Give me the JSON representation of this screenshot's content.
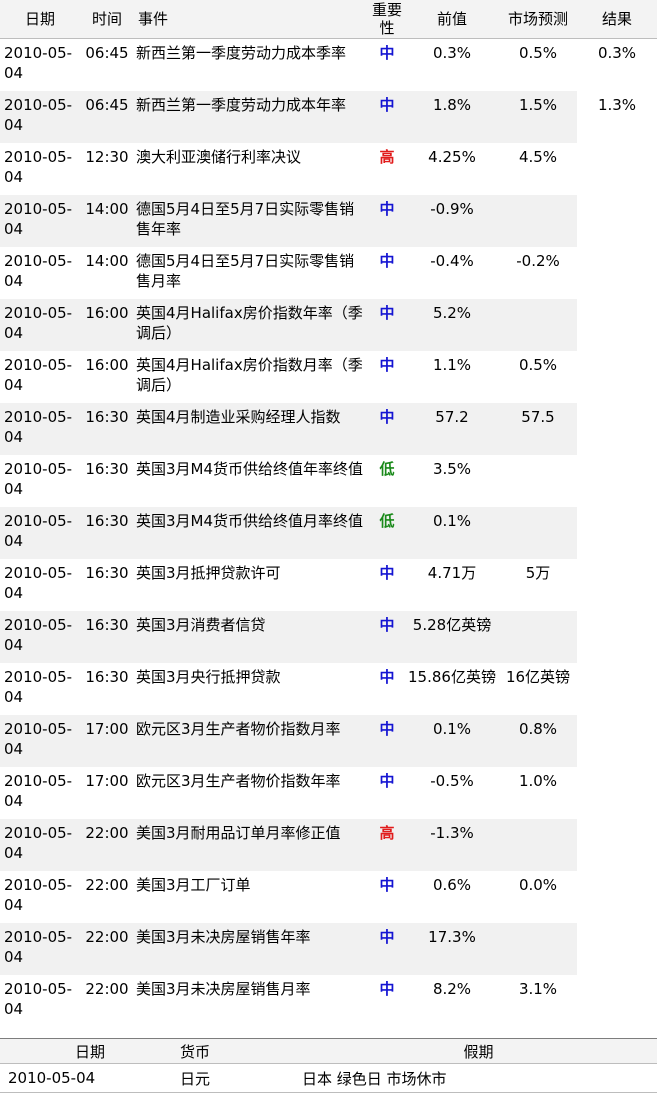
{
  "calendar": {
    "headers": {
      "date": "日期",
      "time": "时间",
      "event": "事件",
      "importance": "重要性",
      "previous": "前值",
      "forecast": "市场预测",
      "actual": "结果"
    },
    "rows": [
      {
        "date": "2010-05-04",
        "time": "06:45",
        "event": "新西兰第一季度劳动力成本季率",
        "importance": "中",
        "level": "mid",
        "previous": "0.3%",
        "forecast": "0.5%",
        "actual": "0.3%"
      },
      {
        "date": "2010-05-04",
        "time": "06:45",
        "event": "新西兰第一季度劳动力成本年率",
        "importance": "中",
        "level": "mid",
        "previous": "1.8%",
        "forecast": "1.5%",
        "actual": "1.3%"
      },
      {
        "date": "2010-05-04",
        "time": "12:30",
        "event": "澳大利亚澳储行利率决议",
        "importance": "高",
        "level": "high",
        "previous": "4.25%",
        "forecast": "4.5%",
        "actual": ""
      },
      {
        "date": "2010-05-04",
        "time": "14:00",
        "event": "德国5月4日至5月7日实际零售销售年率",
        "importance": "中",
        "level": "mid",
        "previous": "-0.9%",
        "forecast": "",
        "actual": ""
      },
      {
        "date": "2010-05-04",
        "time": "14:00",
        "event": "德国5月4日至5月7日实际零售销售月率",
        "importance": "中",
        "level": "mid",
        "previous": "-0.4%",
        "forecast": "-0.2%",
        "actual": ""
      },
      {
        "date": "2010-05-04",
        "time": "16:00",
        "event": "英国4月Halifax房价指数年率（季调后）",
        "importance": "中",
        "level": "mid",
        "previous": "5.2%",
        "forecast": "",
        "actual": ""
      },
      {
        "date": "2010-05-04",
        "time": "16:00",
        "event": "英国4月Halifax房价指数月率（季调后）",
        "importance": "中",
        "level": "mid",
        "previous": "1.1%",
        "forecast": "0.5%",
        "actual": ""
      },
      {
        "date": "2010-05-04",
        "time": "16:30",
        "event": "英国4月制造业采购经理人指数",
        "importance": "中",
        "level": "mid",
        "previous": "57.2",
        "forecast": "57.5",
        "actual": ""
      },
      {
        "date": "2010-05-04",
        "time": "16:30",
        "event": "英国3月M4货币供给终值年率终值",
        "importance": "低",
        "level": "low",
        "previous": "3.5%",
        "forecast": "",
        "actual": ""
      },
      {
        "date": "2010-05-04",
        "time": "16:30",
        "event": "英国3月M4货币供给终值月率终值",
        "importance": "低",
        "level": "low",
        "previous": "0.1%",
        "forecast": "",
        "actual": ""
      },
      {
        "date": "2010-05-04",
        "time": "16:30",
        "event": "英国3月抵押贷款许可",
        "importance": "中",
        "level": "mid",
        "previous": "4.71万",
        "forecast": "5万",
        "actual": ""
      },
      {
        "date": "2010-05-04",
        "time": "16:30",
        "event": "英国3月消费者信贷",
        "importance": "中",
        "level": "mid",
        "previous": "5.28亿英镑",
        "forecast": "",
        "actual": ""
      },
      {
        "date": "2010-05-04",
        "time": "16:30",
        "event": "英国3月央行抵押贷款",
        "importance": "中",
        "level": "mid",
        "previous": "15.86亿英镑",
        "forecast": "16亿英镑",
        "actual": ""
      },
      {
        "date": "2010-05-04",
        "time": "17:00",
        "event": "欧元区3月生产者物价指数月率",
        "importance": "中",
        "level": "mid",
        "previous": "0.1%",
        "forecast": "0.8%",
        "actual": ""
      },
      {
        "date": "2010-05-04",
        "time": "17:00",
        "event": "欧元区3月生产者物价指数年率",
        "importance": "中",
        "level": "mid",
        "previous": "-0.5%",
        "forecast": "1.0%",
        "actual": ""
      },
      {
        "date": "2010-05-04",
        "time": "22:00",
        "event": "美国3月耐用品订单月率修正值",
        "importance": "高",
        "level": "high",
        "previous": "-1.3%",
        "forecast": "",
        "actual": ""
      },
      {
        "date": "2010-05-04",
        "time": "22:00",
        "event": "美国3月工厂订单",
        "importance": "中",
        "level": "mid",
        "previous": "0.6%",
        "forecast": "0.0%",
        "actual": ""
      },
      {
        "date": "2010-05-04",
        "time": "22:00",
        "event": "美国3月未决房屋销售年率",
        "importance": "中",
        "level": "mid",
        "previous": "17.3%",
        "forecast": "",
        "actual": ""
      },
      {
        "date": "2010-05-04",
        "time": "22:00",
        "event": "美国3月未决房屋销售月率",
        "importance": "中",
        "level": "mid",
        "previous": "8.2%",
        "forecast": "3.1%",
        "actual": ""
      }
    ]
  },
  "holidays": {
    "headers": {
      "date": "日期",
      "currency": "货币",
      "holiday": "假期"
    },
    "rows": [
      {
        "date": "2010-05-04",
        "currency": "日元",
        "holiday": "日本 绿色日 市场休市"
      }
    ]
  },
  "colors": {
    "high": "#e11b1b",
    "mid": "#1414d2",
    "low": "#1b8a1b",
    "stripe": "#f1f1f1",
    "header_bg": "#f3f3f3"
  }
}
